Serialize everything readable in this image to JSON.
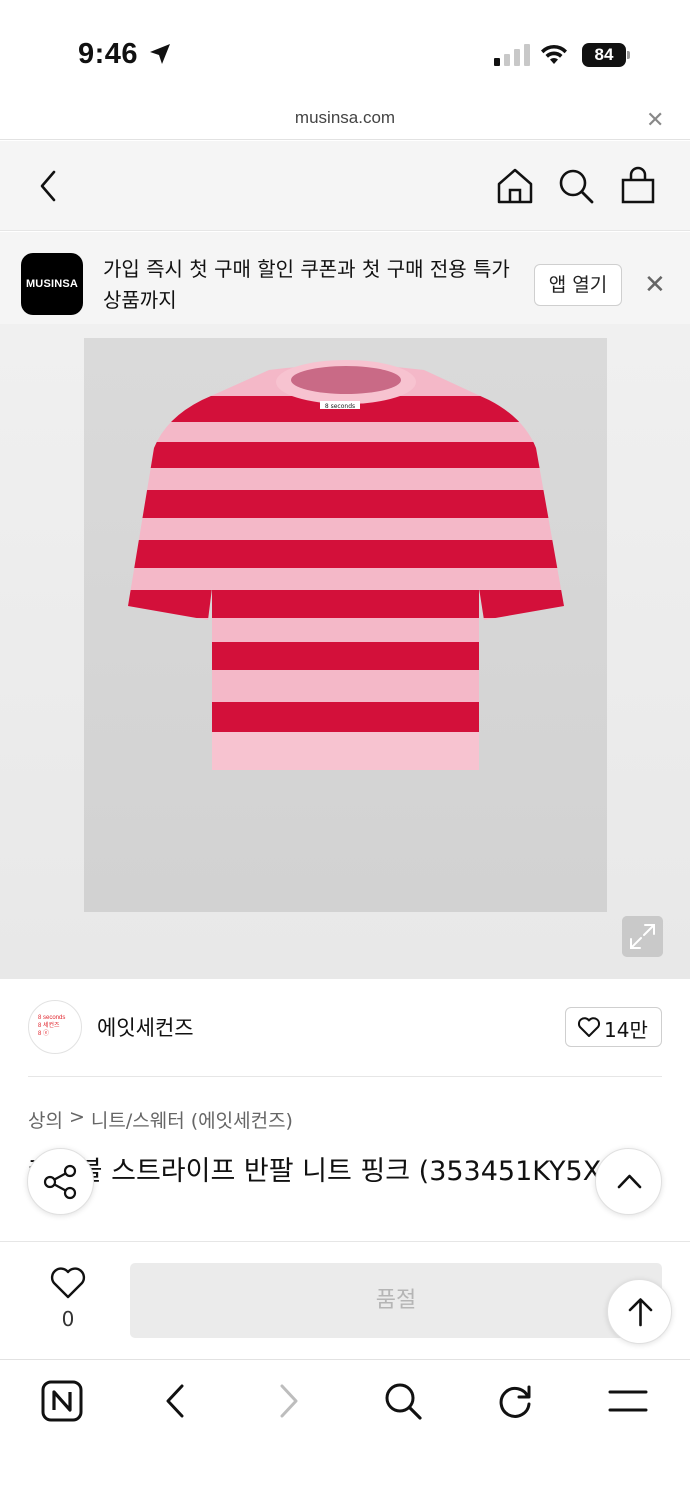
{
  "status_bar": {
    "time": "9:46",
    "battery": "84"
  },
  "url_bar": {
    "url": "musinsa.com"
  },
  "promo": {
    "logo_text": "MUSINSA",
    "message": "가입 즉시 첫 구매 할인 쿠폰과 첫 구매 전용 특가 상품까지",
    "open_app_label": "앱 열기"
  },
  "product_photo": {
    "label_text": "8 seconds",
    "colors": {
      "pink": "#f4b8c8",
      "red": "#d3103a",
      "background": "#d6d6d6"
    }
  },
  "brand": {
    "name": "에잇세컨즈",
    "logo_lines": [
      "8 seconds",
      "8 세컨즈",
      "8 ⓔ"
    ],
    "like_count": "14만"
  },
  "breadcrumb": {
    "level1": "상의",
    "separator": ">",
    "level2": "니트/스웨터 (에잇세컨즈)"
  },
  "product": {
    "title": "케이블 스트라이프 반팔 니트 핑크 (353451KY5X)"
  },
  "purchase_bar": {
    "wish_count": "0",
    "soldout_label": "품절"
  },
  "colors": {
    "brand_red": "#e1252d",
    "disabled_gray": "#ebebeb"
  }
}
